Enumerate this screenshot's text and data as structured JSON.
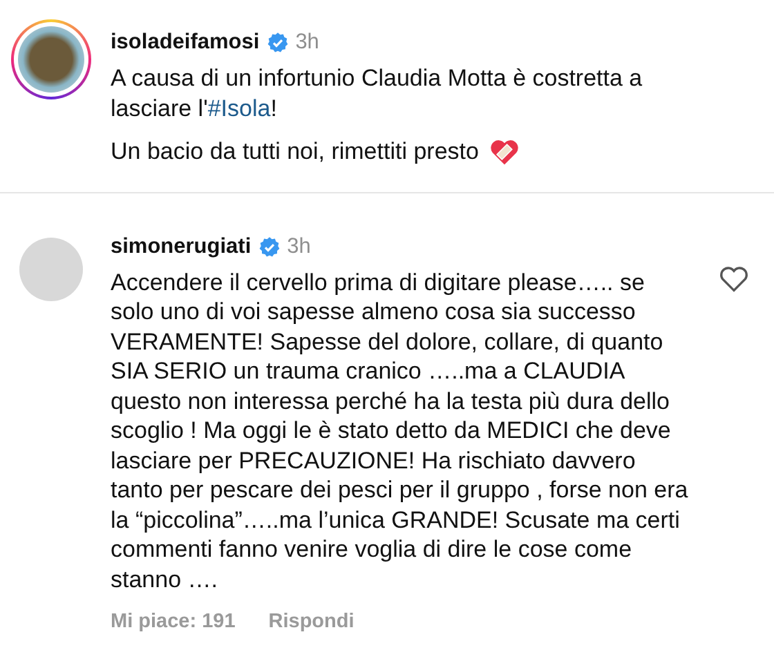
{
  "post": {
    "username": "isoladeifamosi",
    "verified": true,
    "time": "3h",
    "story_ring": true,
    "caption": [
      {
        "kind": "text",
        "text": "A causa di un infortunio Claudia Motta è costretta a lasciare l'"
      },
      {
        "kind": "hashtag",
        "text": "#Isola"
      },
      {
        "kind": "text",
        "text": "!"
      }
    ],
    "caption_line_2": "Un bacio da tutti noi, rimettiti presto"
  },
  "comment": {
    "username": "simonerugiati",
    "verified": true,
    "time": "3h",
    "liked": false,
    "text": "Accendere il cervello prima di digitare please….. se solo uno di voi sapesse almeno cosa sia successo VERAMENTE! Sapesse del dolore, collare, di quanto SIA SERIO un trauma cranico …..ma a CLAUDIA questo non interessa perché ha la testa più dura dello scoglio ! Ma oggi le è stato detto da MEDICI che deve lasciare per PRECAUZIONE!  Ha rischiato davvero tanto per pescare dei pesci per il gruppo , forse non era la “piccolina”…..ma l’unica GRANDE! Scusate ma certi commenti fanno venire voglia di dire le cose come stanno ….",
    "likes": "Mi piace: 191",
    "reply": "Rispondi"
  }
}
